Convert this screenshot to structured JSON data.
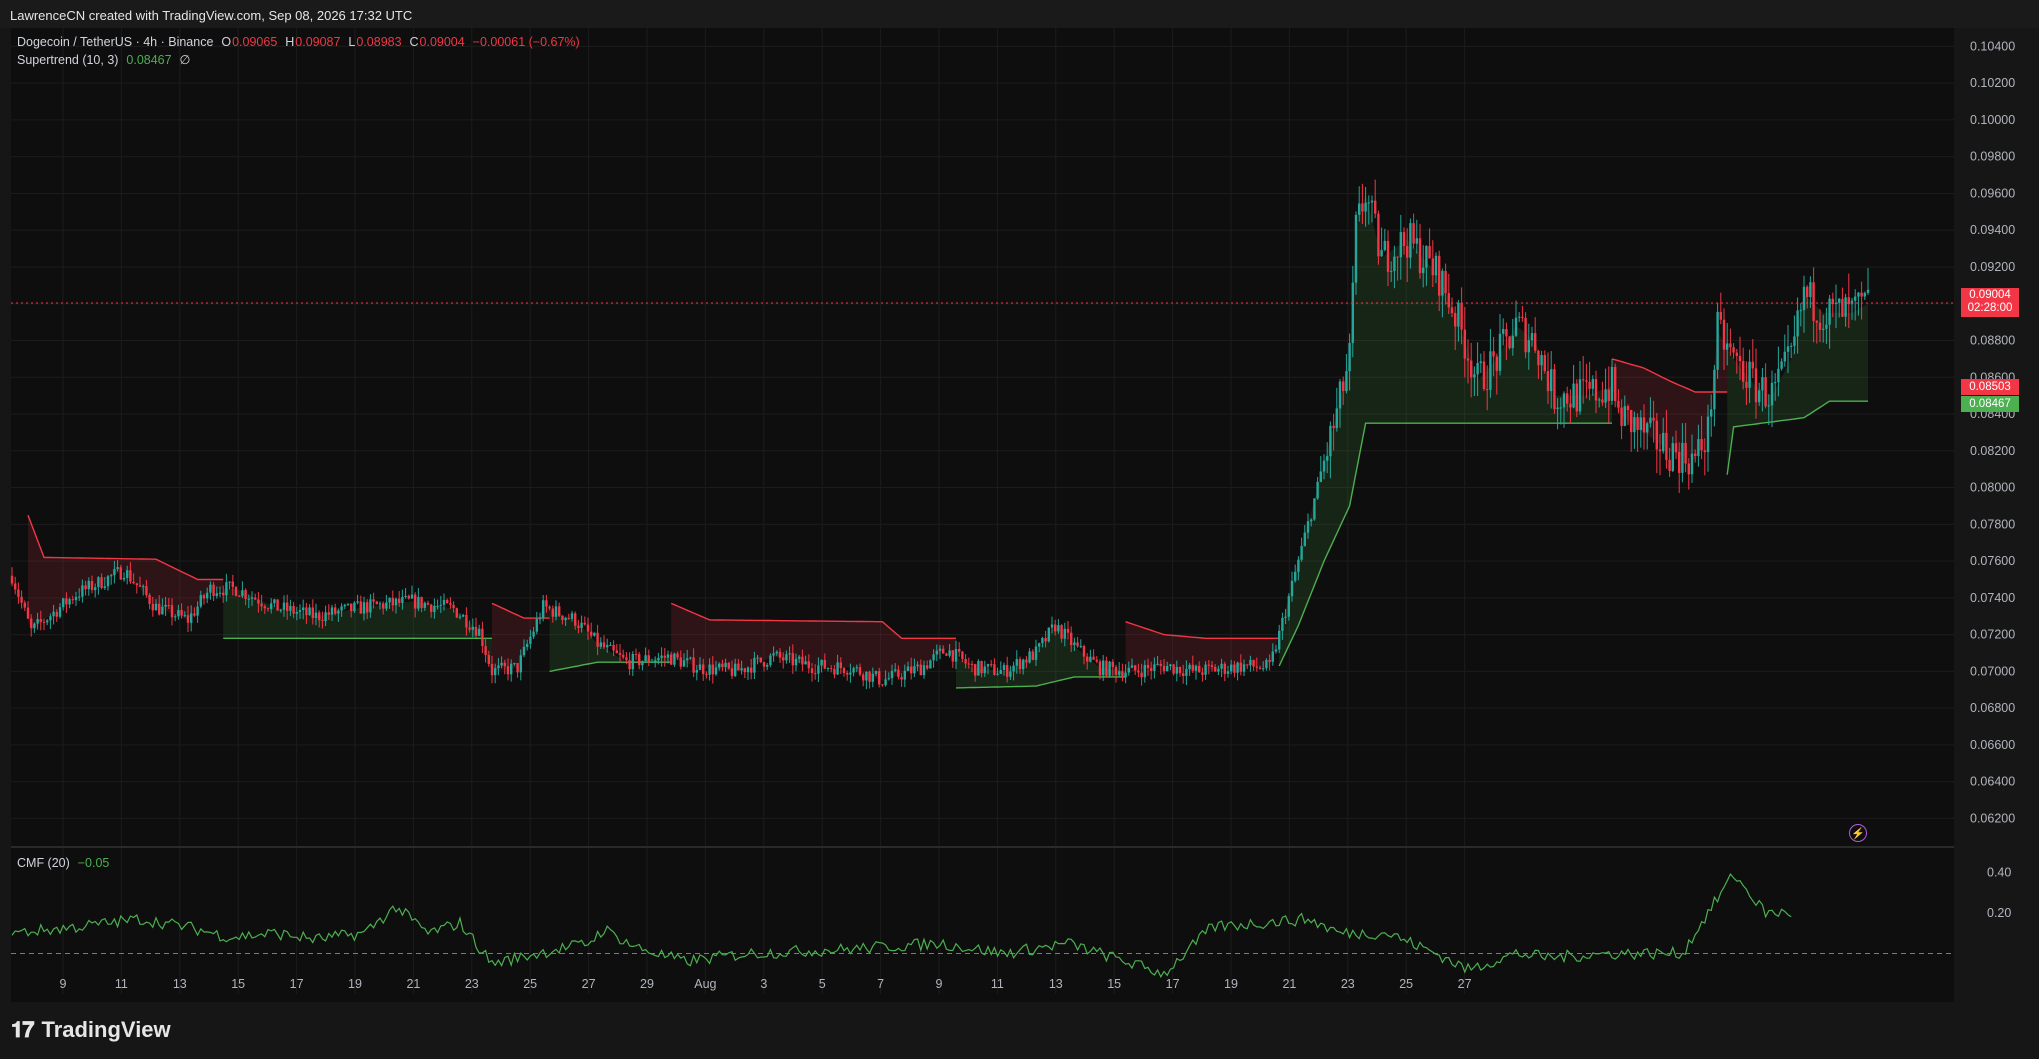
{
  "attribution": "LawrenceCN created with TradingView.com, Sep 08, 2026 17:32 UTC",
  "legend": {
    "symbol": "Dogecoin / TetherUS · 4h · Binance",
    "o_label": "O",
    "o_value": "0.09065",
    "h_label": "H",
    "h_value": "0.09087",
    "l_label": "L",
    "l_value": "0.08983",
    "c_label": "C",
    "c_value": "0.09004",
    "change": "−0.00061 (−0.67%)",
    "supertrend_label": "Supertrend (10, 3)",
    "supertrend_value": "0.08467",
    "supertrend_extra": "∅",
    "cmf_label": "CMF (20)",
    "cmf_value": "−0.05"
  },
  "price_tags": {
    "last_price": "0.09004",
    "countdown": "02:28:00",
    "upper_band": "0.08503",
    "lower_band": "0.08467"
  },
  "brand": {
    "text": "TradingView",
    "icon": "tradingview-logo-icon"
  },
  "colors": {
    "up": "#26a69a",
    "down": "#f23645",
    "supertrend_up": "#4caf50",
    "supertrend_down": "#f23645",
    "cmf": "#4caf50"
  },
  "chart_data": {
    "type": "candlestick",
    "title": "Dogecoin / TetherUS · 4h · Binance",
    "ylim": [
      0.0605,
      0.105
    ],
    "y_ticks": [
      "0.10400",
      "0.10200",
      "0.10000",
      "0.09800",
      "0.09600",
      "0.09400",
      "0.09200",
      "0.09000",
      "0.08800",
      "0.08600",
      "0.08400",
      "0.08200",
      "0.08000",
      "0.07800",
      "0.07600",
      "0.07400",
      "0.07200",
      "0.07000",
      "0.06800",
      "0.06600",
      "0.06400",
      "0.06200"
    ],
    "x_ticks": [
      "9",
      "11",
      "13",
      "15",
      "17",
      "19",
      "21",
      "23",
      "25",
      "27",
      "29",
      "Aug",
      "3",
      "5",
      "7",
      "9",
      "11",
      "13",
      "15",
      "17",
      "19",
      "21",
      "23",
      "25",
      "27"
    ],
    "price_anchors": [
      [
        0,
        0.0752
      ],
      [
        6,
        0.0722
      ],
      [
        20,
        0.0742
      ],
      [
        35,
        0.0755
      ],
      [
        45,
        0.0735
      ],
      [
        55,
        0.0728
      ],
      [
        62,
        0.0745
      ],
      [
        70,
        0.0745
      ],
      [
        82,
        0.0735
      ],
      [
        95,
        0.073
      ],
      [
        110,
        0.0735
      ],
      [
        125,
        0.0738
      ],
      [
        138,
        0.0734
      ],
      [
        146,
        0.0722
      ],
      [
        150,
        0.07
      ],
      [
        158,
        0.0702
      ],
      [
        166,
        0.0735
      ],
      [
        176,
        0.0728
      ],
      [
        183,
        0.0715
      ],
      [
        192,
        0.0705
      ],
      [
        205,
        0.0708
      ],
      [
        215,
        0.0702
      ],
      [
        226,
        0.07
      ],
      [
        238,
        0.0708
      ],
      [
        250,
        0.0703
      ],
      [
        262,
        0.0702
      ],
      [
        272,
        0.0695
      ],
      [
        284,
        0.0702
      ],
      [
        292,
        0.0712
      ],
      [
        300,
        0.0702
      ],
      [
        310,
        0.07
      ],
      [
        320,
        0.071
      ],
      [
        326,
        0.0725
      ],
      [
        333,
        0.0712
      ],
      [
        340,
        0.0702
      ],
      [
        350,
        0.07
      ],
      [
        360,
        0.0703
      ],
      [
        370,
        0.07
      ],
      [
        385,
        0.0703
      ],
      [
        393,
        0.0702
      ],
      [
        396,
        0.072
      ],
      [
        402,
        0.076
      ],
      [
        408,
        0.08
      ],
      [
        414,
        0.084
      ],
      [
        418,
        0.087
      ],
      [
        420,
        0.094
      ],
      [
        423,
        0.096
      ],
      [
        428,
        0.0925
      ],
      [
        436,
        0.0935
      ],
      [
        446,
        0.0915
      ],
      [
        452,
        0.089
      ],
      [
        458,
        0.0858
      ],
      [
        464,
        0.087
      ],
      [
        470,
        0.0888
      ],
      [
        476,
        0.088
      ],
      [
        482,
        0.085
      ],
      [
        492,
        0.085
      ],
      [
        500,
        0.0855
      ],
      [
        502,
        0.084
      ],
      [
        510,
        0.083
      ],
      [
        518,
        0.082
      ],
      [
        526,
        0.0815
      ],
      [
        530,
        0.083
      ],
      [
        533,
        0.0885
      ],
      [
        538,
        0.087
      ],
      [
        545,
        0.0855
      ],
      [
        550,
        0.085
      ],
      [
        556,
        0.087
      ],
      [
        560,
        0.0905
      ],
      [
        566,
        0.0895
      ],
      [
        575,
        0.0895
      ],
      [
        580,
        0.09
      ]
    ],
    "supertrend_segments": [
      {
        "side": "resistance",
        "points": [
          [
            5,
            0.0785
          ],
          [
            10,
            0.0762
          ],
          [
            45,
            0.0761
          ],
          [
            58,
            0.075
          ],
          [
            66,
            0.075
          ]
        ]
      },
      {
        "side": "support",
        "points": [
          [
            66,
            0.0718
          ],
          [
            150,
            0.0718
          ]
        ]
      },
      {
        "side": "resistance",
        "points": [
          [
            150,
            0.0737
          ],
          [
            160,
            0.0729
          ],
          [
            168,
            0.0729
          ]
        ]
      },
      {
        "side": "support",
        "points": [
          [
            168,
            0.07
          ],
          [
            183,
            0.0705
          ],
          [
            206,
            0.0705
          ]
        ]
      },
      {
        "side": "resistance",
        "points": [
          [
            206,
            0.0737
          ],
          [
            218,
            0.0728
          ],
          [
            272,
            0.0727
          ],
          [
            278,
            0.0718
          ],
          [
            295,
            0.0718
          ]
        ]
      },
      {
        "side": "support",
        "points": [
          [
            295,
            0.0691
          ],
          [
            320,
            0.0692
          ],
          [
            332,
            0.0697
          ],
          [
            348,
            0.0697
          ]
        ]
      },
      {
        "side": "resistance",
        "points": [
          [
            348,
            0.0727
          ],
          [
            360,
            0.072
          ],
          [
            373,
            0.0718
          ],
          [
            396,
            0.0718
          ]
        ]
      },
      {
        "side": "support",
        "points": [
          [
            396,
            0.0703
          ],
          [
            402,
            0.0725
          ],
          [
            410,
            0.076
          ],
          [
            418,
            0.079
          ],
          [
            423,
            0.0835
          ],
          [
            500,
            0.0835
          ]
        ]
      },
      {
        "side": "resistance",
        "points": [
          [
            500,
            0.087
          ],
          [
            510,
            0.0865
          ],
          [
            518,
            0.0858
          ],
          [
            526,
            0.0852
          ],
          [
            536,
            0.0852
          ]
        ]
      },
      {
        "side": "support",
        "points": [
          [
            536,
            0.0807
          ],
          [
            538,
            0.0833
          ],
          [
            560,
            0.0838
          ],
          [
            568,
            0.0847
          ],
          [
            580,
            0.0847
          ]
        ]
      }
    ],
    "cmf": {
      "name": "CMF (20)",
      "ylim": [
        -0.2,
        0.52
      ],
      "y_ticks": [
        "0.40",
        "0.20"
      ],
      "anchors": [
        [
          0,
          0.1
        ],
        [
          20,
          0.13
        ],
        [
          40,
          0.17
        ],
        [
          55,
          0.13
        ],
        [
          68,
          0.08
        ],
        [
          82,
          0.1
        ],
        [
          95,
          0.07
        ],
        [
          110,
          0.1
        ],
        [
          120,
          0.23
        ],
        [
          130,
          0.1
        ],
        [
          140,
          0.15
        ],
        [
          150,
          -0.05
        ],
        [
          170,
          0.02
        ],
        [
          180,
          0.05
        ],
        [
          185,
          0.12
        ],
        [
          195,
          0.03
        ],
        [
          210,
          -0.04
        ],
        [
          230,
          0.0
        ],
        [
          260,
          0.02
        ],
        [
          290,
          0.05
        ],
        [
          310,
          0.0
        ],
        [
          330,
          0.05
        ],
        [
          350,
          -0.05
        ],
        [
          360,
          -0.1
        ],
        [
          375,
          0.13
        ],
        [
          390,
          0.15
        ],
        [
          405,
          0.17
        ],
        [
          415,
          0.1
        ],
        [
          430,
          0.1
        ],
        [
          445,
          0.0
        ],
        [
          455,
          -0.08
        ],
        [
          470,
          0.0
        ],
        [
          480,
          -0.02
        ],
        [
          500,
          0.0
        ],
        [
          515,
          0.0
        ],
        [
          522,
          0.0
        ],
        [
          530,
          0.2
        ],
        [
          538,
          0.39
        ],
        [
          548,
          0.2
        ],
        [
          556,
          0.2
        ]
      ]
    }
  }
}
